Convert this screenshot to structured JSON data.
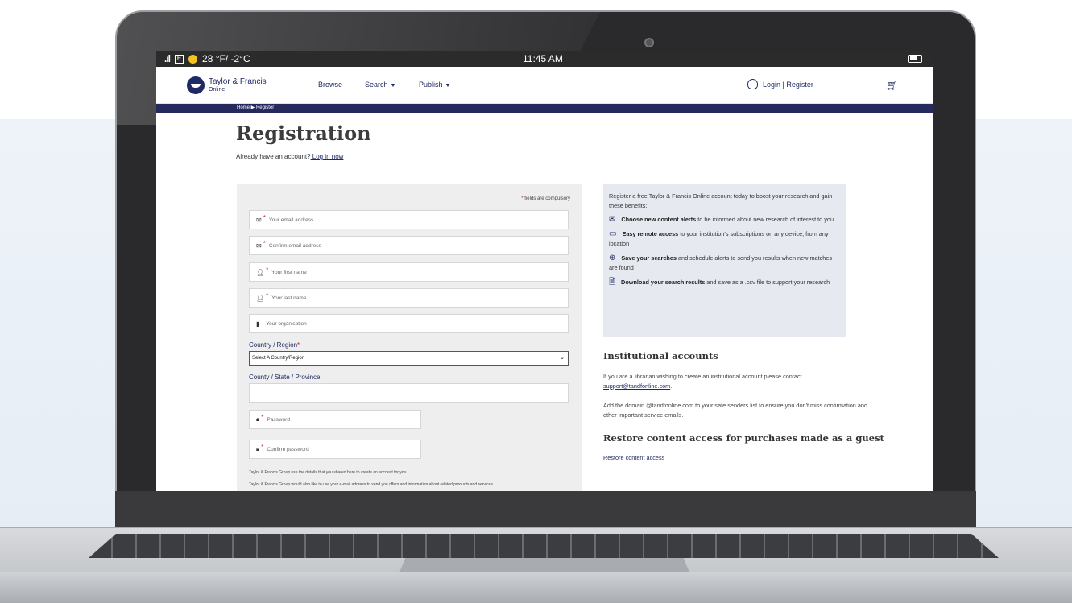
{
  "status_bar": {
    "signal": ".ıl",
    "network_badge": "E",
    "weather": "28 °F/ -2°C",
    "time": "11:45 AM"
  },
  "header": {
    "logo_line1": "Taylor & Francis",
    "logo_line2": "Online",
    "nav": [
      {
        "label": "Browse"
      },
      {
        "label": "Search"
      },
      {
        "label": "Publish"
      }
    ],
    "login_label": "Login | Register"
  },
  "breadcrumb": "Home  ▶  Register",
  "page": {
    "title": "Registration",
    "already_text": "Already have an account?",
    "login_link": " Log in now"
  },
  "form": {
    "compulsory_note": "fields are compulsory",
    "email_placeholder": "Your email address",
    "confirm_email_placeholder": "Confirm email address",
    "first_name_placeholder": "Your first name",
    "last_name_placeholder": "Your last name",
    "organisation_placeholder": "Your organisation",
    "country_label": "Country / Region",
    "country_selected": "Select A Country/Region",
    "county_label": "County / State / Province",
    "password_placeholder": "Password",
    "confirm_password_placeholder": "Confirm password",
    "fine_print_1": "Taylor & Francis Group use the details that you shared here to create an account for you.",
    "fine_print_2": "Taylor & Francis Group would also like to use your e-mail address to send you offers and information about related products and services."
  },
  "benefits": {
    "intro": "Register a free Taylor & Francis Online account today to boost your research and gain these benefits:",
    "items": [
      {
        "icon": "envelope-icon",
        "bold": "Choose new content alerts",
        "rest": " to be informed about new research of interest to you"
      },
      {
        "icon": "laptop-icon",
        "bold": "Easy remote access",
        "rest": " to your institution's subscriptions on any device, from any location"
      },
      {
        "icon": "search-plus-icon",
        "bold": "Save your searches",
        "rest": " and schedule alerts to send you results when new matches are found"
      },
      {
        "icon": "file-download-icon",
        "bold": "Download your search results",
        "rest": " and save as a .csv file to support your research"
      }
    ]
  },
  "institutional": {
    "title": "Institutional accounts",
    "p1": "If you are a librarian wishing to create an institutional account please contact",
    "email_link": "support@tandfonline.com",
    "p2": "Add the domain @tandfonline.com to your safe senders list to ensure you don't miss confirmation and other important service emails."
  },
  "restore": {
    "title": "Restore content access for purchases made as a guest",
    "link": "Restore content access"
  },
  "colors": {
    "brand_navy": "#1f2a64",
    "required_red": "#c22222",
    "panel_grey": "#eeeeee",
    "benefits_bg": "#e6eaf0"
  }
}
